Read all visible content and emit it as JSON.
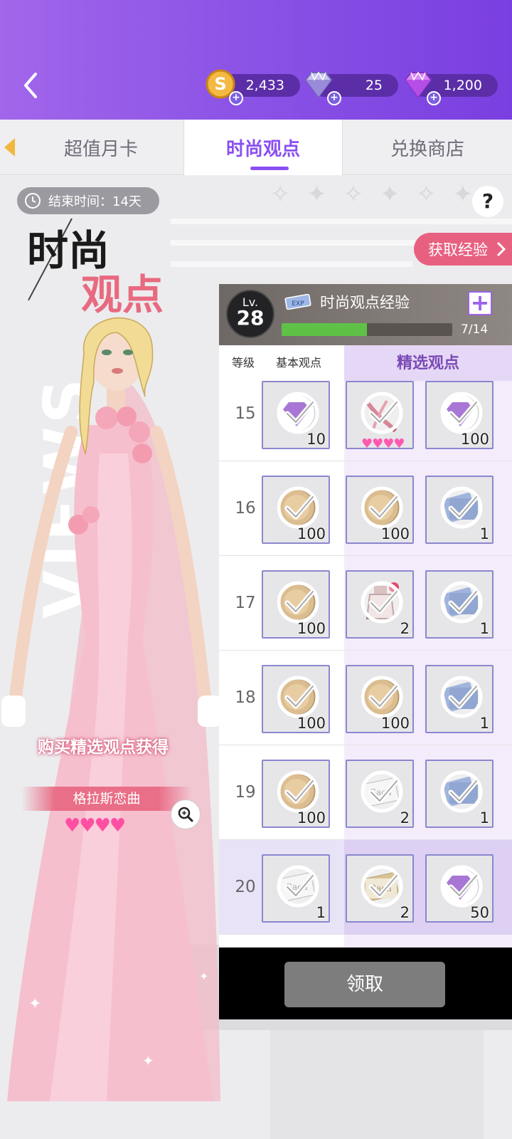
{
  "header": {
    "currencies": [
      {
        "name": "coin",
        "value": "2,433",
        "color": "#e2a33a"
      },
      {
        "name": "diamond",
        "value": "25",
        "color": "#9a8bd8"
      },
      {
        "name": "gem",
        "value": "1,200",
        "color": "#b44ee6"
      }
    ]
  },
  "tabs": [
    {
      "label": "超值月卡"
    },
    {
      "label": "时尚观点",
      "active": true
    },
    {
      "label": "兑换商店"
    }
  ],
  "promo": {
    "end_time": "结束时间：14天",
    "title_line1": "时尚",
    "title_line2": "观点",
    "bg_text": "VIEWS",
    "get_exp_label": "获取经验",
    "buy_tip": "购买精选观点获得",
    "dress_name": "格拉斯恋曲",
    "dress_hearts": "♥♥♥♥",
    "help": "?"
  },
  "panel": {
    "level_label": "Lv.",
    "level": "28",
    "exp_title": "时尚观点经验",
    "exp_progress": "7/14",
    "exp_fraction": 0.5,
    "col_level": "等级",
    "col_basic": "基本观点",
    "col_premium": "精选观点",
    "claim_label": "领取",
    "rows": [
      {
        "level": "15",
        "items": [
          {
            "icon": "purple-gem-icon",
            "qty": "10"
          },
          {
            "icon": "accessory-icon",
            "qty": ""
          },
          {
            "icon": "purple-gem-icon",
            "qty": "100"
          }
        ],
        "hearts": "♥♥♥♥"
      },
      {
        "level": "16",
        "items": [
          {
            "icon": "gold-coin-icon",
            "qty": "100"
          },
          {
            "icon": "gold-coin-icon",
            "qty": "100"
          },
          {
            "icon": "blue-ticket-icon",
            "qty": "1"
          }
        ]
      },
      {
        "level": "17",
        "items": [
          {
            "icon": "gold-coin-icon",
            "qty": "100"
          },
          {
            "icon": "potion-icon",
            "qty": "2"
          },
          {
            "icon": "blue-ticket-icon",
            "qty": "1"
          }
        ]
      },
      {
        "level": "18",
        "items": [
          {
            "icon": "gold-coin-icon",
            "qty": "100"
          },
          {
            "icon": "gold-coin-icon",
            "qty": "100"
          },
          {
            "icon": "blue-ticket-icon",
            "qty": "1"
          }
        ]
      },
      {
        "level": "19",
        "items": [
          {
            "icon": "gold-coin-icon",
            "qty": "100"
          },
          {
            "icon": "gacha-ticket-icon",
            "qty": "2"
          },
          {
            "icon": "blue-ticket-icon",
            "qty": "1"
          }
        ]
      },
      {
        "level": "20",
        "items": [
          {
            "icon": "gacha-ticket-icon",
            "qty": "1"
          },
          {
            "icon": "gold-gacha-ticket-icon",
            "qty": "2"
          },
          {
            "icon": "purple-gem-icon",
            "qty": "50"
          }
        ],
        "highlight": true
      }
    ]
  }
}
